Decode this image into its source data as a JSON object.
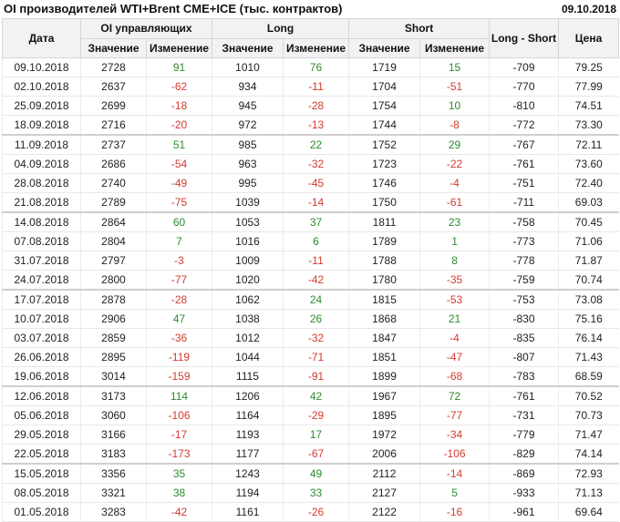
{
  "header": {
    "title": "OI производителей WTI+Brent CME+ICE (тыс. контрактов)",
    "date": "09.10.2018"
  },
  "columns": {
    "date": "Дата",
    "oi_group": "OI управляющих",
    "long_group": "Long",
    "short_group": "Short",
    "long_minus_short": "Long - Short",
    "price": "Цена",
    "value": "Значение",
    "change": "Изменение"
  },
  "rows": [
    {
      "date": "09.10.2018",
      "oi": "2728",
      "oi_chg": "91",
      "long": "1010",
      "long_chg": "76",
      "short": "1719",
      "short_chg": "15",
      "ls": "-709",
      "price": "79.25"
    },
    {
      "date": "02.10.2018",
      "oi": "2637",
      "oi_chg": "-62",
      "long": "934",
      "long_chg": "-11",
      "short": "1704",
      "short_chg": "-51",
      "ls": "-770",
      "price": "77.99"
    },
    {
      "date": "25.09.2018",
      "oi": "2699",
      "oi_chg": "-18",
      "long": "945",
      "long_chg": "-28",
      "short": "1754",
      "short_chg": "10",
      "ls": "-810",
      "price": "74.51"
    },
    {
      "date": "18.09.2018",
      "oi": "2716",
      "oi_chg": "-20",
      "long": "972",
      "long_chg": "-13",
      "short": "1744",
      "short_chg": "-8",
      "ls": "-772",
      "price": "73.30"
    },
    {
      "date": "11.09.2018",
      "oi": "2737",
      "oi_chg": "51",
      "long": "985",
      "long_chg": "22",
      "short": "1752",
      "short_chg": "29",
      "ls": "-767",
      "price": "72.11"
    },
    {
      "date": "04.09.2018",
      "oi": "2686",
      "oi_chg": "-54",
      "long": "963",
      "long_chg": "-32",
      "short": "1723",
      "short_chg": "-22",
      "ls": "-761",
      "price": "73.60"
    },
    {
      "date": "28.08.2018",
      "oi": "2740",
      "oi_chg": "-49",
      "long": "995",
      "long_chg": "-45",
      "short": "1746",
      "short_chg": "-4",
      "ls": "-751",
      "price": "72.40"
    },
    {
      "date": "21.08.2018",
      "oi": "2789",
      "oi_chg": "-75",
      "long": "1039",
      "long_chg": "-14",
      "short": "1750",
      "short_chg": "-61",
      "ls": "-711",
      "price": "69.03"
    },
    {
      "date": "14.08.2018",
      "oi": "2864",
      "oi_chg": "60",
      "long": "1053",
      "long_chg": "37",
      "short": "1811",
      "short_chg": "23",
      "ls": "-758",
      "price": "70.45"
    },
    {
      "date": "07.08.2018",
      "oi": "2804",
      "oi_chg": "7",
      "long": "1016",
      "long_chg": "6",
      "short": "1789",
      "short_chg": "1",
      "ls": "-773",
      "price": "71.06"
    },
    {
      "date": "31.07.2018",
      "oi": "2797",
      "oi_chg": "-3",
      "long": "1009",
      "long_chg": "-11",
      "short": "1788",
      "short_chg": "8",
      "ls": "-778",
      "price": "71.87"
    },
    {
      "date": "24.07.2018",
      "oi": "2800",
      "oi_chg": "-77",
      "long": "1020",
      "long_chg": "-42",
      "short": "1780",
      "short_chg": "-35",
      "ls": "-759",
      "price": "70.74"
    },
    {
      "date": "17.07.2018",
      "oi": "2878",
      "oi_chg": "-28",
      "long": "1062",
      "long_chg": "24",
      "short": "1815",
      "short_chg": "-53",
      "ls": "-753",
      "price": "73.08"
    },
    {
      "date": "10.07.2018",
      "oi": "2906",
      "oi_chg": "47",
      "long": "1038",
      "long_chg": "26",
      "short": "1868",
      "short_chg": "21",
      "ls": "-830",
      "price": "75.16"
    },
    {
      "date": "03.07.2018",
      "oi": "2859",
      "oi_chg": "-36",
      "long": "1012",
      "long_chg": "-32",
      "short": "1847",
      "short_chg": "-4",
      "ls": "-835",
      "price": "76.14"
    },
    {
      "date": "26.06.2018",
      "oi": "2895",
      "oi_chg": "-119",
      "long": "1044",
      "long_chg": "-71",
      "short": "1851",
      "short_chg": "-47",
      "ls": "-807",
      "price": "71.43"
    },
    {
      "date": "19.06.2018",
      "oi": "3014",
      "oi_chg": "-159",
      "long": "1115",
      "long_chg": "-91",
      "short": "1899",
      "short_chg": "-68",
      "ls": "-783",
      "price": "68.59"
    },
    {
      "date": "12.06.2018",
      "oi": "3173",
      "oi_chg": "114",
      "long": "1206",
      "long_chg": "42",
      "short": "1967",
      "short_chg": "72",
      "ls": "-761",
      "price": "70.52"
    },
    {
      "date": "05.06.2018",
      "oi": "3060",
      "oi_chg": "-106",
      "long": "1164",
      "long_chg": "-29",
      "short": "1895",
      "short_chg": "-77",
      "ls": "-731",
      "price": "70.73"
    },
    {
      "date": "29.05.2018",
      "oi": "3166",
      "oi_chg": "-17",
      "long": "1193",
      "long_chg": "17",
      "short": "1972",
      "short_chg": "-34",
      "ls": "-779",
      "price": "71.47"
    },
    {
      "date": "22.05.2018",
      "oi": "3183",
      "oi_chg": "-173",
      "long": "1177",
      "long_chg": "-67",
      "short": "2006",
      "short_chg": "-106",
      "ls": "-829",
      "price": "74.14"
    },
    {
      "date": "15.05.2018",
      "oi": "3356",
      "oi_chg": "35",
      "long": "1243",
      "long_chg": "49",
      "short": "2112",
      "short_chg": "-14",
      "ls": "-869",
      "price": "72.93"
    },
    {
      "date": "08.05.2018",
      "oi": "3321",
      "oi_chg": "38",
      "long": "1194",
      "long_chg": "33",
      "short": "2127",
      "short_chg": "5",
      "ls": "-933",
      "price": "71.13"
    },
    {
      "date": "01.05.2018",
      "oi": "3283",
      "oi_chg": "-42",
      "long": "1161",
      "long_chg": "-26",
      "short": "2122",
      "short_chg": "-16",
      "ls": "-961",
      "price": "69.64"
    }
  ],
  "month_start_rows": [
    4,
    8,
    12,
    17,
    21
  ],
  "colors": {
    "positive": "#2e8b2e",
    "negative": "#d23b2f",
    "header_bg": "#f2f2f2"
  }
}
